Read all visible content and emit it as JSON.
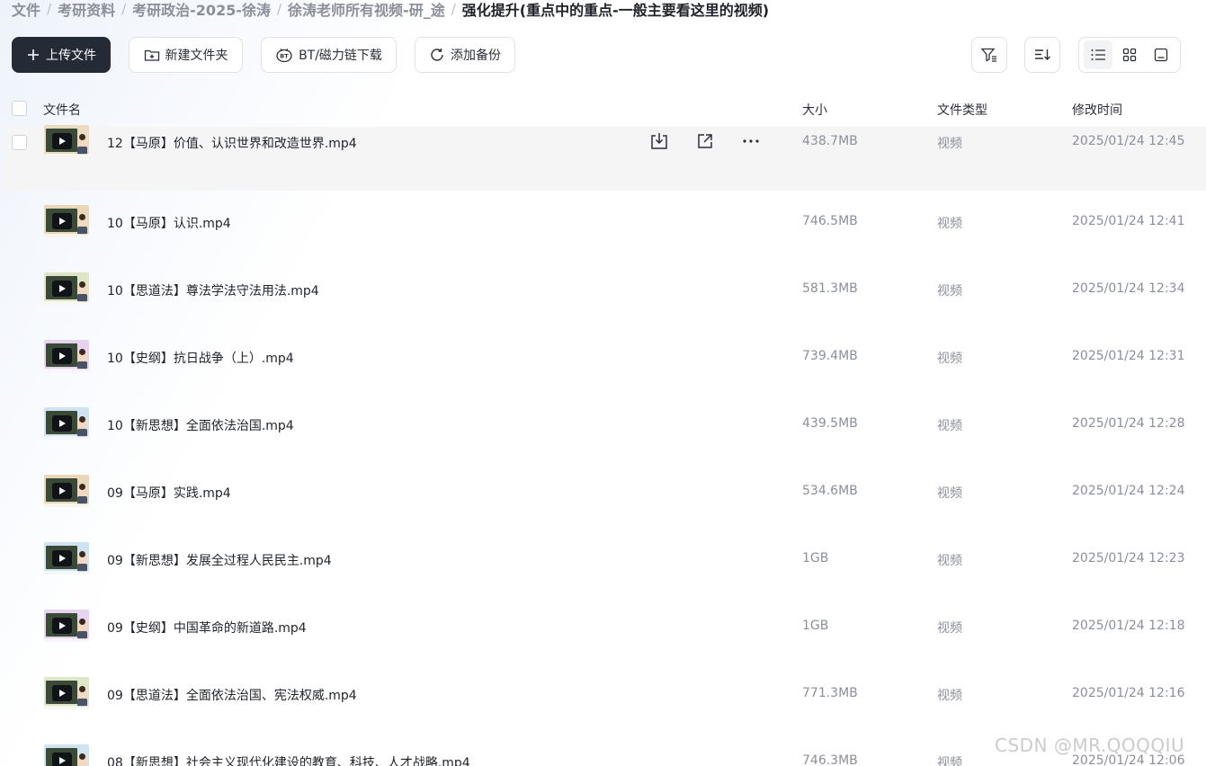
{
  "breadcrumb": [
    "文件",
    "考研资料",
    "考研政治-2025-徐涛",
    "徐涛老师所有视频-研_途",
    "强化提升(重点中的重点-一般主要看这里的视频)"
  ],
  "toolbar": {
    "upload_label": "上传文件",
    "new_folder_label": "新建文件夹",
    "bt_label": "BT/磁力链下载",
    "backup_label": "添加备份"
  },
  "columns": {
    "name": "文件名",
    "size": "大小",
    "type": "文件类型",
    "modified": "修改时间"
  },
  "files": [
    {
      "name": "12【马原】价值、认识世界和改造世界.mp4",
      "size": "438.7MB",
      "type": "视频",
      "modified": "2025/01/24 12:45",
      "thumb_accent": "#e9dcc0",
      "hover": true
    },
    {
      "name": "10【马原】认识.mp4",
      "size": "746.5MB",
      "type": "视频",
      "modified": "2025/01/24 12:41",
      "thumb_accent": "#e8d8b8"
    },
    {
      "name": "10【思道法】尊法学法守法用法.mp4",
      "size": "581.3MB",
      "type": "视频",
      "modified": "2025/01/24 12:34",
      "thumb_accent": "#dfe6c8"
    },
    {
      "name": "10【史纲】抗日战争（上）.mp4",
      "size": "739.4MB",
      "type": "视频",
      "modified": "2025/01/24 12:31",
      "thumb_accent": "#e7d3ef"
    },
    {
      "name": "10【新思想】全面依法治国.mp4",
      "size": "439.5MB",
      "type": "视频",
      "modified": "2025/01/24 12:28",
      "thumb_accent": "#cfe3f0"
    },
    {
      "name": "09【马原】实践.mp4",
      "size": "534.6MB",
      "type": "视频",
      "modified": "2025/01/24 12:24",
      "thumb_accent": "#e8d8b8"
    },
    {
      "name": "09【新思想】发展全过程人民民主.mp4",
      "size": "1GB",
      "type": "视频",
      "modified": "2025/01/24 12:23",
      "thumb_accent": "#cfe3f0"
    },
    {
      "name": "09【史纲】中国革命的新道路.mp4",
      "size": "1GB",
      "type": "视频",
      "modified": "2025/01/24 12:18",
      "thumb_accent": "#e7d3ef"
    },
    {
      "name": "09【思道法】全面依法治国、宪法权威.mp4",
      "size": "771.3MB",
      "type": "视频",
      "modified": "2025/01/24 12:16",
      "thumb_accent": "#dfe6c8"
    },
    {
      "name": "08【新思想】社会主义现代化建设的教育、科技、人才战略.mp4",
      "size": "746.3MB",
      "type": "视频",
      "modified": "2025/01/24 12:06",
      "thumb_accent": "#cfe3f0"
    }
  ],
  "watermark": "CSDN @MR.QOQQIU"
}
